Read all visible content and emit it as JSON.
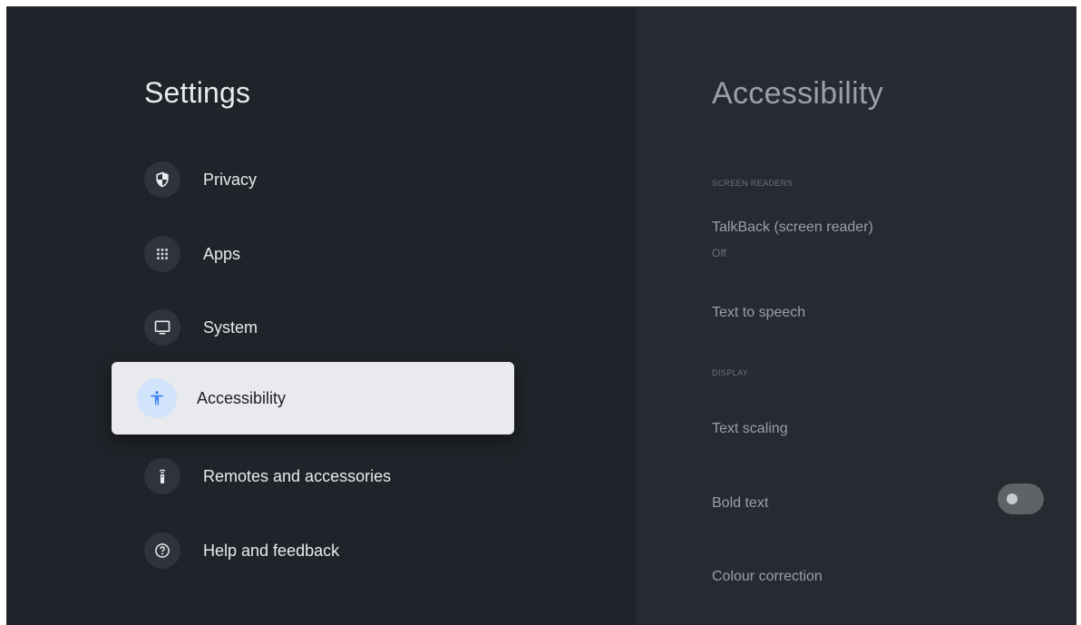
{
  "settings": {
    "title": "Settings",
    "menu": [
      {
        "label": "Privacy",
        "icon": "shield-icon"
      },
      {
        "label": "Apps",
        "icon": "apps-grid-icon"
      },
      {
        "label": "System",
        "icon": "monitor-icon"
      },
      {
        "label": "Accessibility",
        "icon": "accessibility-icon",
        "selected": true
      },
      {
        "label": "Remotes and accessories",
        "icon": "remote-icon"
      },
      {
        "label": "Help and feedback",
        "icon": "help-icon"
      }
    ]
  },
  "accessibility": {
    "title": "Accessibility",
    "sections": [
      {
        "header": "SCREEN READERS",
        "items": [
          {
            "label": "TalkBack (screen reader)",
            "value": "Off"
          },
          {
            "label": "Text to speech"
          }
        ]
      },
      {
        "header": "DISPLAY",
        "items": [
          {
            "label": "Text scaling"
          },
          {
            "label": "Bold text",
            "toggle": "off"
          },
          {
            "label": "Colour correction"
          }
        ]
      }
    ]
  },
  "colors": {
    "background": "#202329",
    "detail_background": "#272a31",
    "selected_background": "#e8eaed",
    "accent": "#4285f4"
  }
}
